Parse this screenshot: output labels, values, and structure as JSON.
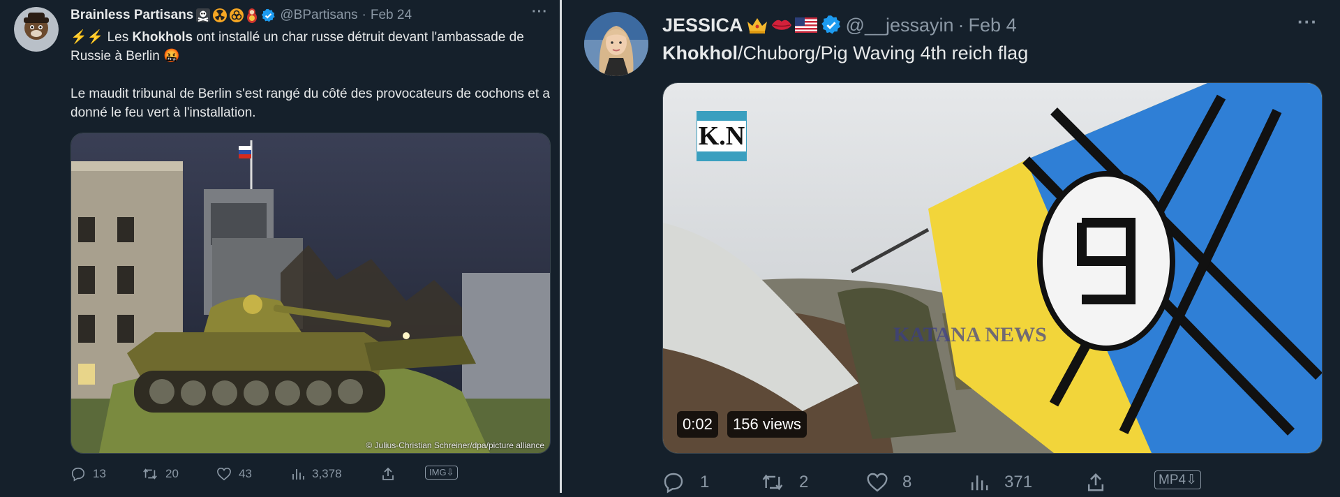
{
  "tweets": [
    {
      "author_name": "Brainless Partisans",
      "handle": "@BPartisans",
      "date": "Feb 24",
      "body": {
        "p1_prefix": "⚡⚡ Les ",
        "p1_bold": "Khokhols",
        "p1_suffix": " ont installé un char russe détruit devant l'ambassade de Russie à Berlin 🤬",
        "p2": "Le maudit tribunal de Berlin s'est rangé du côté des provocateurs de cochons et a donné le feu vert à l'installation."
      },
      "media": {
        "type": "image",
        "credit": "© Julius-Christian Schreiner/dpa/picture alliance"
      },
      "actions": {
        "replies": "13",
        "reposts": "20",
        "likes": "43",
        "views": "3,378",
        "media_button": "IMG⇩"
      },
      "icons": [
        "skull-crossbones-icon",
        "radioactive-icon",
        "biohazard-icon",
        "doll-icon",
        "verified-badge-icon",
        "more-icon"
      ]
    },
    {
      "author_name": "JESSICA",
      "handle": "@__jessayin",
      "date": "Feb 4",
      "body": {
        "bold": "Khokhol",
        "rest": "/Chuborg/Pig Waving 4th reich flag"
      },
      "media": {
        "type": "video",
        "logo": "K.N",
        "watermark": "KATANA NEWS",
        "duration": "0:02",
        "views": "156 views"
      },
      "actions": {
        "replies": "1",
        "reposts": "2",
        "likes": "8",
        "views": "371",
        "media_button": "MP4⇩"
      },
      "icons": [
        "crown-icon",
        "lips-icon",
        "us-flag-icon",
        "verified-badge-icon",
        "more-icon"
      ]
    }
  ],
  "colors": {
    "background": "#15202b",
    "text": "#e7e9ea",
    "muted": "#8b98a5",
    "verified": "#1d9bf0"
  }
}
